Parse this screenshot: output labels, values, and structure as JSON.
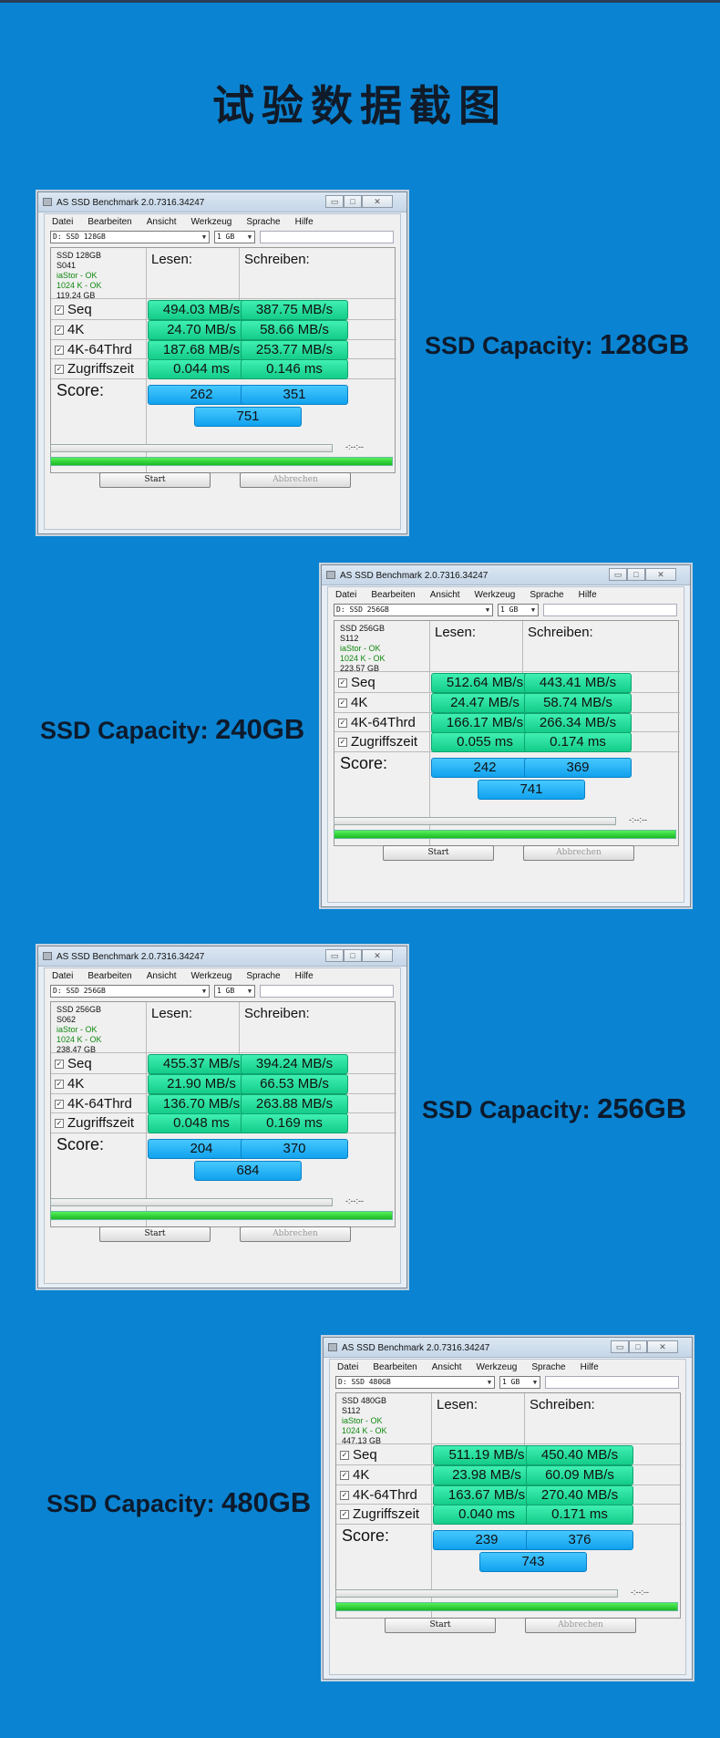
{
  "page_title": "试验数据截图",
  "app": {
    "title": "AS SSD Benchmark 2.0.7316.34247",
    "menu": [
      "Datei",
      "Bearbeiten",
      "Ansicht",
      "Werkzeug",
      "Sprache",
      "Hilfe"
    ],
    "col_read": "Lesen:",
    "col_write": "Schreiben:",
    "score_label": "Score:",
    "time_text": "-:--:--",
    "start_label": "Start",
    "abort_label": "Abbrechen",
    "ctrl_minimize": "▭",
    "ctrl_maximize": "□",
    "ctrl_close": "✕",
    "row_labels": [
      "Seq",
      "4K",
      "4K-64Thrd",
      "Zugriffszeit"
    ]
  },
  "caption_prefix": "SSD Capacity:",
  "benchmarks": [
    {
      "capacity": "128GB",
      "drive": "D: SSD 128GB",
      "size": "1 GB",
      "info": [
        "SSD 128GB",
        "S041",
        "iaStor - OK",
        "1024 K - OK",
        "119.24 GB"
      ],
      "read": [
        "494.03 MB/s",
        "24.70 MB/s",
        "187.68 MB/s",
        "0.044 ms"
      ],
      "write": [
        "387.75 MB/s",
        "58.66 MB/s",
        "253.77 MB/s",
        "0.146 ms"
      ],
      "score_read": "262",
      "score_write": "351",
      "score_total": "751"
    },
    {
      "capacity": "240GB",
      "drive": "D: SSD 256GB",
      "size": "1 GB",
      "info": [
        "SSD 256GB",
        "S112",
        "iaStor - OK",
        "1024 K - OK",
        "223.57 GB"
      ],
      "read": [
        "512.64 MB/s",
        "24.47 MB/s",
        "166.17 MB/s",
        "0.055 ms"
      ],
      "write": [
        "443.41 MB/s",
        "58.74 MB/s",
        "266.34 MB/s",
        "0.174 ms"
      ],
      "score_read": "242",
      "score_write": "369",
      "score_total": "741"
    },
    {
      "capacity": "256GB",
      "drive": "D: SSD 256GB",
      "size": "1 GB",
      "info": [
        "SSD 256GB",
        "S062",
        "iaStor - OK",
        "1024 K - OK",
        "238.47 GB"
      ],
      "read": [
        "455.37 MB/s",
        "21.90 MB/s",
        "136.70 MB/s",
        "0.048 ms"
      ],
      "write": [
        "394.24 MB/s",
        "66.53 MB/s",
        "263.88 MB/s",
        "0.169 ms"
      ],
      "score_read": "204",
      "score_write": "370",
      "score_total": "684"
    },
    {
      "capacity": "480GB",
      "drive": "D: SSD 480GB",
      "size": "1 GB",
      "info": [
        "SSD 480GB",
        "S112",
        "iaStor - OK",
        "1024 K - OK",
        "447.13 GB"
      ],
      "read": [
        "511.19 MB/s",
        "23.98 MB/s",
        "163.67 MB/s",
        "0.040 ms"
      ],
      "write": [
        "450.40 MB/s",
        "60.09 MB/s",
        "270.40 MB/s",
        "0.171 ms"
      ],
      "score_read": "239",
      "score_write": "376",
      "score_total": "743"
    }
  ]
}
